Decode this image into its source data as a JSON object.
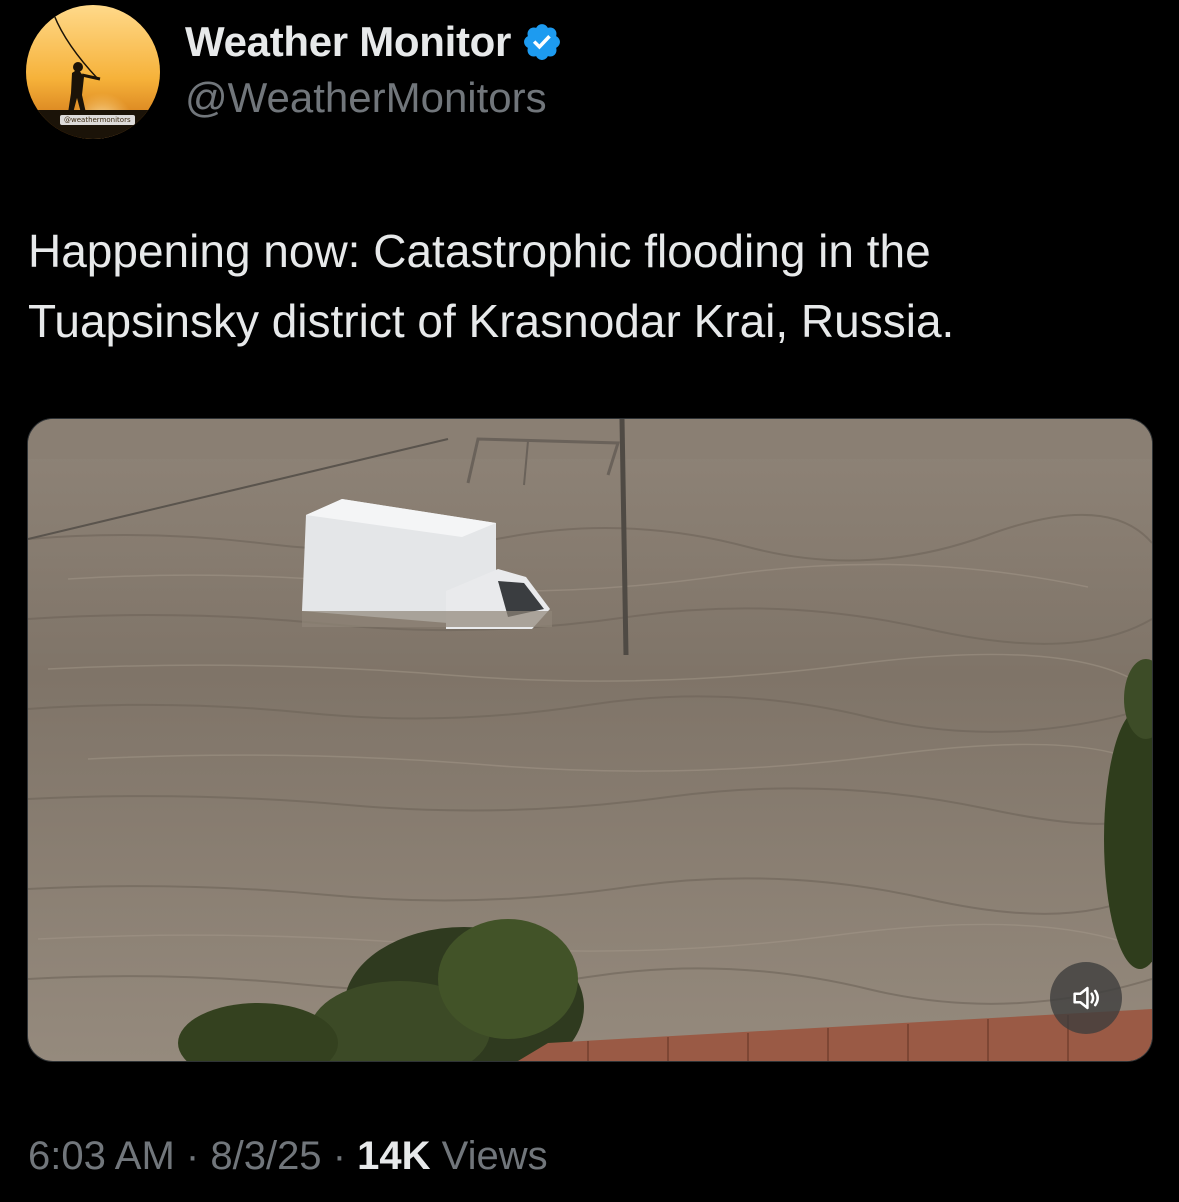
{
  "author": {
    "display_name": "Weather Monitor",
    "handle": "@WeatherMonitors",
    "avatar_caption": "@weathermonitors",
    "verified": true,
    "verified_color": "#1d9bf0"
  },
  "tweet": {
    "text": "Happening now: Catastrophic flooding in the Tuapsinsky district of Krasnodar Krai, Russia."
  },
  "media": {
    "type": "video",
    "sound_icon": "speaker-muted-icon"
  },
  "meta": {
    "time": "6:03 AM",
    "separator": "·",
    "date": "8/3/25",
    "views_count": "14K",
    "views_label": "Views"
  },
  "colors": {
    "background": "#000000",
    "primary_text": "#e7e9ea",
    "secondary_text": "#71767b"
  }
}
